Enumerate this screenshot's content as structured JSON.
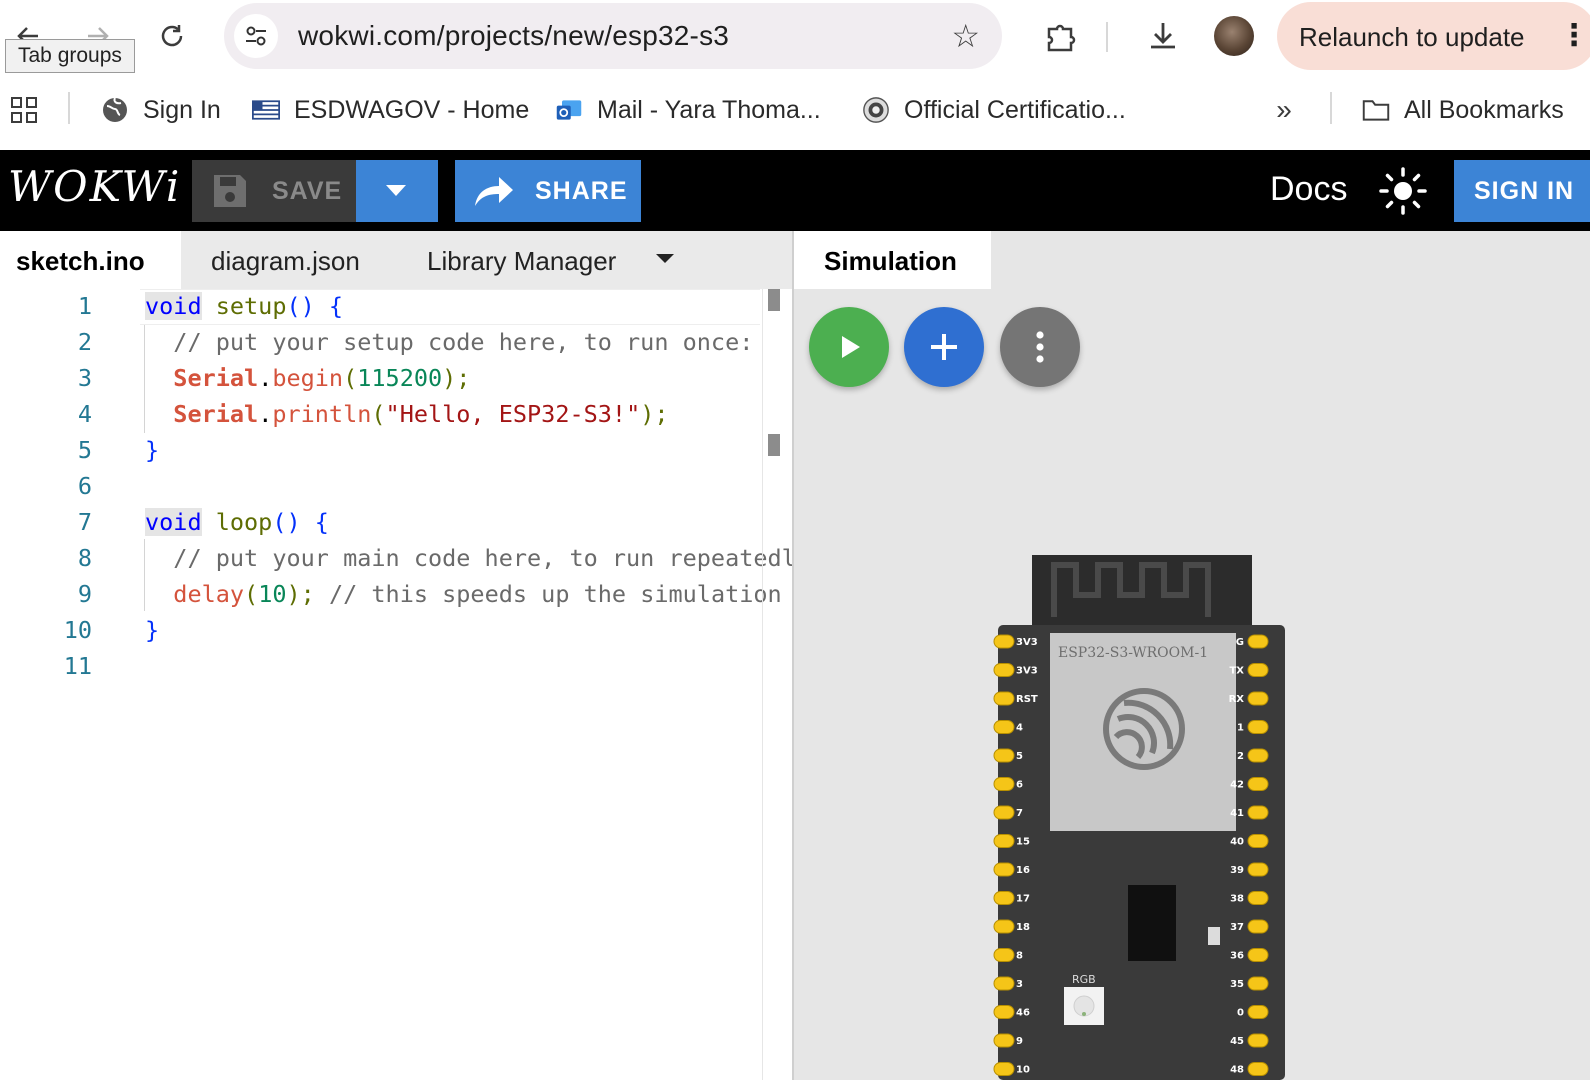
{
  "browser": {
    "tooltip": "Tab groups",
    "url": "wokwi.com/projects/new/esp32-s3",
    "relaunch_label": "Relaunch to update",
    "bookmarks": [
      {
        "label": "Sign In",
        "icon": "globe-icon"
      },
      {
        "label": "ESDWAGOV - Home",
        "icon": "flag-icon"
      },
      {
        "label": "Mail - Yara Thoma...",
        "icon": "outlook-icon"
      },
      {
        "label": "Official Certificatio...",
        "icon": "seal-icon"
      }
    ],
    "all_bookmarks_label": "All Bookmarks"
  },
  "header": {
    "logo": "WOKWi",
    "save_label": "SAVE",
    "share_label": "SHARE",
    "docs_label": "Docs",
    "signin_label": "SIGN IN",
    "accent_color": "#3c84d6"
  },
  "editor": {
    "tabs": [
      "sketch.ino",
      "diagram.json",
      "Library Manager"
    ],
    "active_tab": "sketch.ino",
    "line_numbers": [
      "1",
      "2",
      "3",
      "4",
      "5",
      "6",
      "7",
      "8",
      "9",
      "10",
      "11"
    ],
    "code": {
      "l1_kw": "void",
      "l1_fn": " setup",
      "l1_rest": "() {",
      "l2": "  // put your setup code here, to run once:",
      "l3_obj": "Serial",
      "l3_dot": ".",
      "l3_mth": "begin",
      "l3_p1": "(",
      "l3_num": "115200",
      "l3_p2": ");",
      "l4_obj": "Serial",
      "l4_dot": ".",
      "l4_mth": "println",
      "l4_p1": "(",
      "l4_str": "\"Hello, ESP32-S3!\"",
      "l4_p2": ");",
      "l5": "}",
      "l7_kw": "void",
      "l7_fn": " loop",
      "l7_rest": "() {",
      "l8": "  // put your main code here, to run repeatedly:",
      "l9_mth": "delay",
      "l9_p1": "(",
      "l9_num": "10",
      "l9_p2": "); ",
      "l9_cmt": "// this speeds up the simulation",
      "l10": "}"
    }
  },
  "simulation": {
    "tab_label": "Simulation",
    "play_color": "#4caf50",
    "add_color": "#2f6fd1",
    "more_color": "#757575",
    "board": {
      "module_label": "ESP32-S3-WROOM-1",
      "rgb_label": "RGB",
      "left_pins": [
        "3V3",
        "3V3",
        "RST",
        "4",
        "5",
        "6",
        "7",
        "15",
        "16",
        "17",
        "18",
        "8",
        "3",
        "46",
        "9",
        "10"
      ],
      "right_pins": [
        "G",
        "TX",
        "RX",
        "1",
        "2",
        "42",
        "41",
        "40",
        "39",
        "38",
        "37",
        "36",
        "35",
        "0",
        "45",
        "48"
      ]
    }
  }
}
